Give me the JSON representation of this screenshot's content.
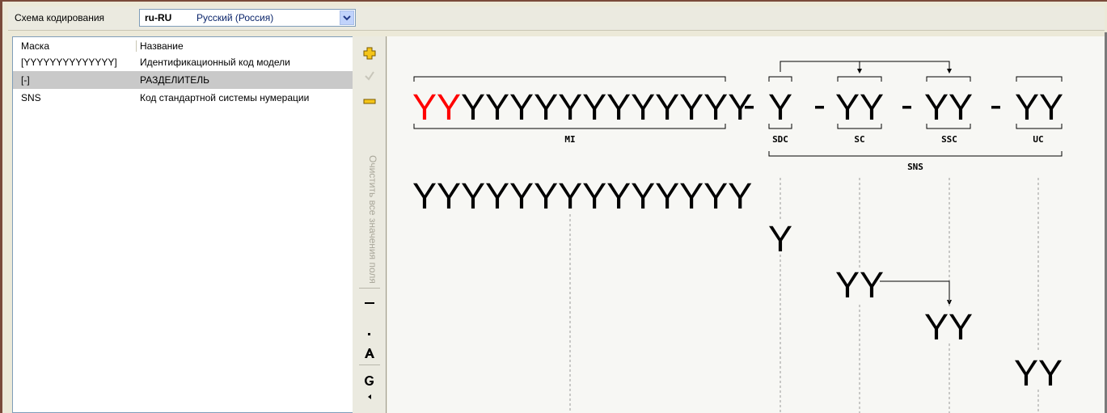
{
  "toolbar": {
    "encoding_label": "Схема кодирования",
    "encoding_code": "ru-RU",
    "encoding_name": "Русский (Россия)"
  },
  "list": {
    "columns": [
      "Маска",
      "Название"
    ],
    "rows": [
      {
        "mask": "[YYYYYYYYYYYYYY]",
        "name": "Идентификационный код модели"
      },
      {
        "mask": "[-]",
        "name": "РАЗДЕЛИТЕЛЬ"
      },
      {
        "mask": "SNS",
        "name": "Код стандартной системы нумерации"
      }
    ],
    "selected_index": 1
  },
  "sidebar": {
    "vertical_label": "Очистить все значения поля",
    "icons": [
      "add-icon",
      "check-icon",
      "remove-icon",
      "dash-icon",
      "dot-icon",
      "font-a-icon",
      "font-g-icon"
    ]
  },
  "diagram": {
    "mi_red": "YY",
    "mi_black": "YYYYYYYYYYYY",
    "mi_full": "YYYYYYYYYYYYYY",
    "sep": "-",
    "sdc": "Y",
    "sc": "YY",
    "ssc": "YY",
    "uc": "YY",
    "labels": {
      "mi": "MI",
      "sdc": "SDC",
      "sc": "SC",
      "ssc": "SSC",
      "uc": "UC",
      "sns": "SNS"
    },
    "colors": {
      "accent": "#ff0000",
      "text": "#000000",
      "guide": "#808080"
    }
  }
}
